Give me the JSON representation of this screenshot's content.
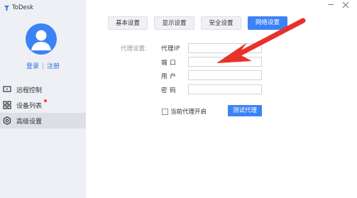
{
  "app": {
    "title": "ToDesk",
    "logo_icon": "todesk-logo-icon",
    "accent": "#3b82f6"
  },
  "auth": {
    "login": "登录",
    "separator": "|",
    "register": "注册"
  },
  "sidebar": {
    "items": [
      {
        "label": "远程控制",
        "icon": "monitor-icon",
        "active": false,
        "badge": false
      },
      {
        "label": "设备列表",
        "icon": "grid-icon",
        "active": false,
        "badge": true
      },
      {
        "label": "高级设置",
        "icon": "hexagon-settings-icon",
        "active": true,
        "badge": false
      }
    ]
  },
  "tabs": [
    {
      "label": "基本设置",
      "active": false
    },
    {
      "label": "显示设置",
      "active": false
    },
    {
      "label": "安全设置",
      "active": false
    },
    {
      "label": "网络设置",
      "active": true
    }
  ],
  "proxy": {
    "section_label": "代理设置:",
    "fields": [
      {
        "label": "代理IP",
        "value": ""
      },
      {
        "label": "端 口",
        "value": ""
      },
      {
        "label": "用 户",
        "value": ""
      },
      {
        "label": "密 码",
        "value": ""
      }
    ],
    "enable_label": "当前代理开启",
    "enabled": false,
    "test_button": "测试代理"
  },
  "annotation": {
    "arrow_color": "#e8312a"
  }
}
